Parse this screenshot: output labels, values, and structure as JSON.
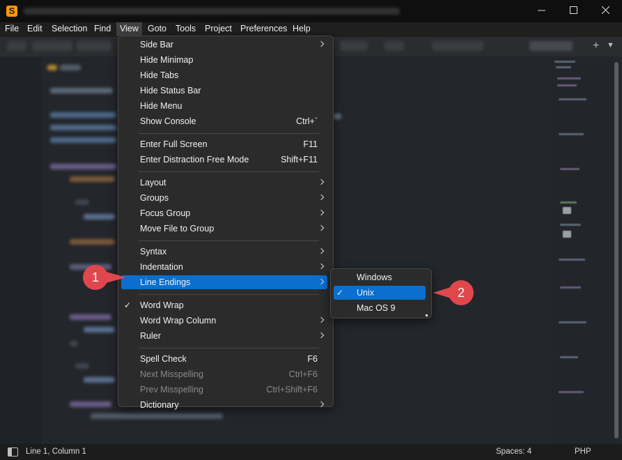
{
  "window": {
    "logo": "S",
    "controls": {
      "minimize": "minimize-icon",
      "maximize": "maximize-icon",
      "close": "close-icon"
    }
  },
  "menubar": [
    "File",
    "Edit",
    "Selection",
    "Find",
    "View",
    "Goto",
    "Tools",
    "Project",
    "Preferences",
    "Help"
  ],
  "tabbar": {
    "add_icon": "+",
    "overflow_icon": "▼"
  },
  "view_menu": {
    "items": [
      {
        "label": "Side Bar",
        "submenu": true
      },
      {
        "label": "Hide Minimap"
      },
      {
        "label": "Hide Tabs"
      },
      {
        "label": "Hide Status Bar"
      },
      {
        "label": "Hide Menu"
      },
      {
        "label": "Show Console",
        "shortcut": "Ctrl+`"
      },
      {
        "separator": true
      },
      {
        "label": "Enter Full Screen",
        "shortcut": "F11"
      },
      {
        "label": "Enter Distraction Free Mode",
        "shortcut": "Shift+F11"
      },
      {
        "separator": true
      },
      {
        "label": "Layout",
        "submenu": true
      },
      {
        "label": "Groups",
        "submenu": true
      },
      {
        "label": "Focus Group",
        "submenu": true
      },
      {
        "label": "Move File to Group",
        "submenu": true
      },
      {
        "separator": true
      },
      {
        "label": "Syntax",
        "submenu": true
      },
      {
        "label": "Indentation",
        "submenu": true
      },
      {
        "label": "Line Endings",
        "submenu": true,
        "highlighted": true
      },
      {
        "separator": true
      },
      {
        "label": "Word Wrap",
        "checked": true
      },
      {
        "label": "Word Wrap Column",
        "submenu": true
      },
      {
        "label": "Ruler",
        "submenu": true
      },
      {
        "separator": true
      },
      {
        "label": "Spell Check",
        "shortcut": "F6"
      },
      {
        "label": "Next Misspelling",
        "shortcut": "Ctrl+F6",
        "disabled": true
      },
      {
        "label": "Prev Misspelling",
        "shortcut": "Ctrl+Shift+F6",
        "disabled": true
      },
      {
        "label": "Dictionary",
        "submenu": true
      }
    ]
  },
  "line_endings_submenu": {
    "items": [
      {
        "label": "Windows"
      },
      {
        "label": "Unix",
        "checked": true,
        "highlighted": true
      },
      {
        "label": "Mac OS 9"
      }
    ]
  },
  "callouts": {
    "first": "1",
    "second": "2",
    "color": "#e0474c"
  },
  "statusbar": {
    "position": "Line 1, Column 1",
    "spaces": "Spaces: 4",
    "syntax": "PHP"
  },
  "colors": {
    "accent": "#0a6fcf",
    "menu_bg": "#2b2b2b",
    "editor_bg": "#23262b"
  }
}
